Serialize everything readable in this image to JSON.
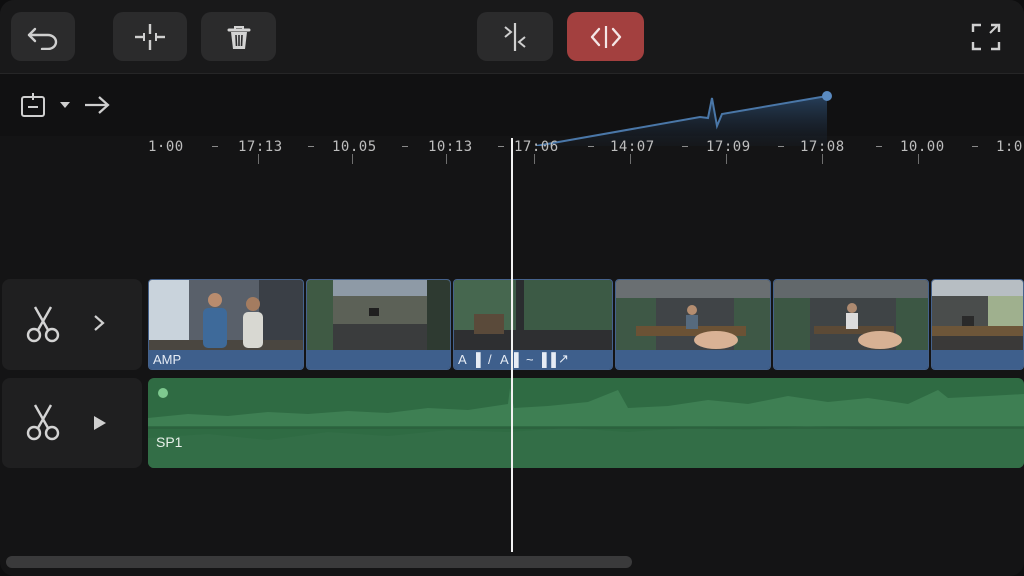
{
  "toolbar": {
    "buttons": [
      {
        "name": "undo",
        "icon": "undo-icon"
      },
      {
        "name": "split",
        "icon": "split-icon"
      },
      {
        "name": "delete",
        "icon": "trash-icon"
      },
      {
        "name": "trim",
        "icon": "trim-icon"
      },
      {
        "name": "ripple-edit",
        "icon": "code-brackets-icon",
        "active": true
      },
      {
        "name": "fullscreen",
        "icon": "fullscreen-icon"
      }
    ],
    "active_color": "#a3403f"
  },
  "secondary": {
    "items": [
      "calendar-icon",
      "chevron-down-icon",
      "arrow-right-icon"
    ]
  },
  "ruler": {
    "labels": [
      "1·00",
      "17:13",
      "10.05",
      "10:13",
      "17:06",
      "14:07",
      "17:09",
      "17:08",
      "10.00",
      "1:0"
    ]
  },
  "tracks": {
    "video": {
      "label": "AMP",
      "clip_labels": [
        "A",
        "▌",
        "/",
        "A",
        "▌",
        "~",
        "▌▌",
        "↗"
      ],
      "color": "#3e5f8c"
    },
    "audio": {
      "label": "SP1",
      "color": "#2f6b43"
    },
    "heads": [
      {
        "name": "video-track-head",
        "icon": "scissors-icon",
        "toggle": "chevron-right-icon"
      },
      {
        "name": "audio-track-head",
        "icon": "scissors-icon",
        "toggle": "play-icon"
      }
    ]
  },
  "colors": {
    "background": "#141415",
    "curve": "#4a77a8"
  }
}
